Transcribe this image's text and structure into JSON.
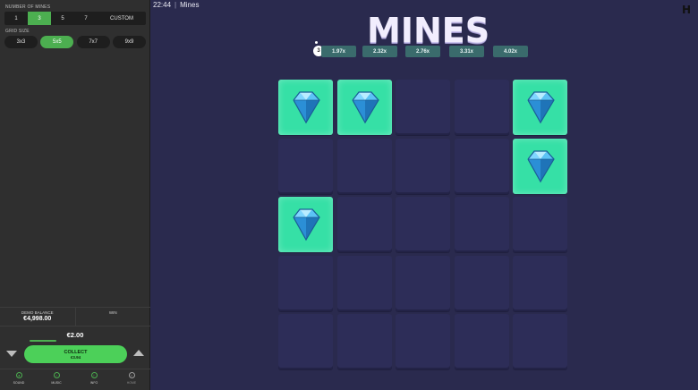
{
  "topbar": {
    "time": "22:44",
    "separator": "|",
    "game_title": "Mines"
  },
  "brand": {
    "logo_text": "H"
  },
  "title": "MINES",
  "sidebar": {
    "mines_label": "NUMBER OF MINES",
    "mines_options": [
      "1",
      "3",
      "5",
      "7",
      "CUSTOM"
    ],
    "mines_selected": "3",
    "grid_label": "GRID SIZE",
    "grid_options": [
      "3x3",
      "5x5",
      "7x7",
      "9x9"
    ],
    "grid_selected": "5x5",
    "balance_label": "DEMO BALANCE",
    "balance_value": "€4,998.00",
    "win_label": "WIN",
    "win_value": "",
    "bet_amount": "€2.00",
    "collect_label": "COLLECT",
    "collect_value": "€3.94",
    "nav": [
      {
        "label": "SOUND",
        "icon": "speaker-icon"
      },
      {
        "label": "MUSIC",
        "icon": "music-note-icon"
      },
      {
        "label": "INFO",
        "icon": "info-icon"
      },
      {
        "label": "HOME",
        "icon": "home-icon"
      }
    ]
  },
  "multipliers": {
    "mines_count": "3",
    "values": [
      "1.97x",
      "2.32x",
      "2.76x",
      "3.31x",
      "4.02x"
    ]
  },
  "board": {
    "rows": 5,
    "cols": 5,
    "revealed_gems": [
      [
        0,
        0
      ],
      [
        0,
        1
      ],
      [
        0,
        4
      ],
      [
        1,
        4
      ],
      [
        2,
        0
      ]
    ]
  },
  "colors": {
    "accent": "#4caf50",
    "gem_tile": "#36e0a6",
    "hidden_tile": "#2d2d58",
    "background": "#2a2a4e",
    "multiplier_bg": "#3a6b6c"
  }
}
